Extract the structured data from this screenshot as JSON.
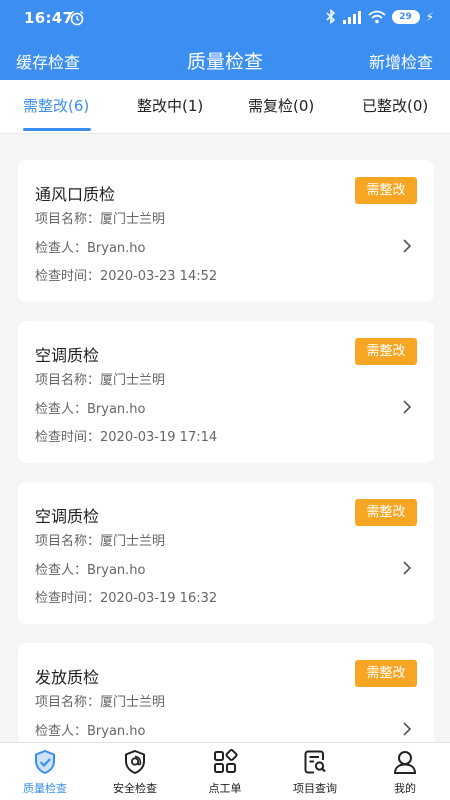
{
  "status_bar": {
    "time": "16:47",
    "battery": "29"
  },
  "nav": {
    "left": "缓存检查",
    "title": "质量检查",
    "right": "新增检查"
  },
  "tabs": [
    {
      "label": "需整改(6)",
      "active": true
    },
    {
      "label": "整改中(1)",
      "active": false
    },
    {
      "label": "需复检(0)",
      "active": false
    },
    {
      "label": "已整改(0)",
      "active": false
    }
  ],
  "cards": [
    {
      "title": "通风口质检",
      "badge": "需整改",
      "project": "项目名称：厦门士兰明",
      "inspector": "检查人：Bryan.ho",
      "time": "检查时间：2020-03-23 14:52"
    },
    {
      "title": "空调质检",
      "badge": "需整改",
      "project": "项目名称：厦门士兰明",
      "inspector": "检查人：Bryan.ho",
      "time": "检查时间：2020-03-19 17:14"
    },
    {
      "title": "空调质检",
      "badge": "需整改",
      "project": "项目名称：厦门士兰明",
      "inspector": "检查人：Bryan.ho",
      "time": "检查时间：2020-03-19 16:32"
    },
    {
      "title": "发放质检",
      "badge": "需整改",
      "project": "项目名称：厦门士兰明",
      "inspector": "检查人：Bryan.ho",
      "time": ""
    }
  ],
  "bottom_nav": [
    {
      "label": "质量检查",
      "icon": "shield-check-icon",
      "active": true
    },
    {
      "label": "安全检查",
      "icon": "at-shield-icon",
      "active": false
    },
    {
      "label": "点工单",
      "icon": "grid-icon",
      "active": false
    },
    {
      "label": "项目查询",
      "icon": "doc-search-icon",
      "active": false
    },
    {
      "label": "我的",
      "icon": "user-icon",
      "active": false
    }
  ],
  "colors": {
    "primary": "#3c8ff0",
    "badge": "#f6a623",
    "background": "#f4f5f7"
  }
}
